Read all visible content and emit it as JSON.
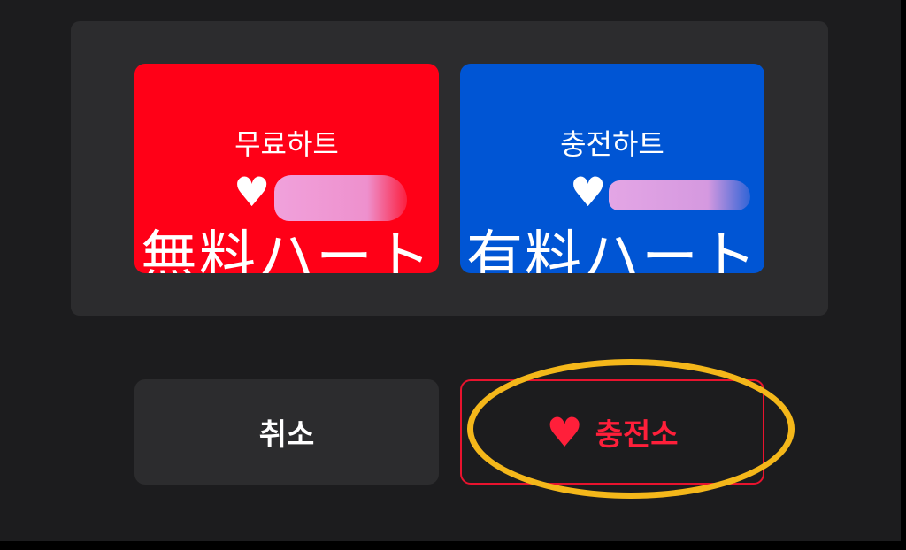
{
  "cards": {
    "free": {
      "title": "무료하트",
      "overlay": "無料ハート",
      "icon": "heart-icon"
    },
    "paid": {
      "title": "충전하트",
      "overlay": "有料ハート",
      "icon": "heart-icon"
    }
  },
  "buttons": {
    "cancel_label": "취소",
    "charge_label": "충전소",
    "charge_icon": "heart-icon"
  },
  "colors": {
    "background": "#1c1c1e",
    "panel": "#2c2c2e",
    "free_card": "#ff0017",
    "paid_card": "#0055d4",
    "accent_red": "#ff1f3a",
    "highlight": "#f4b71a"
  }
}
